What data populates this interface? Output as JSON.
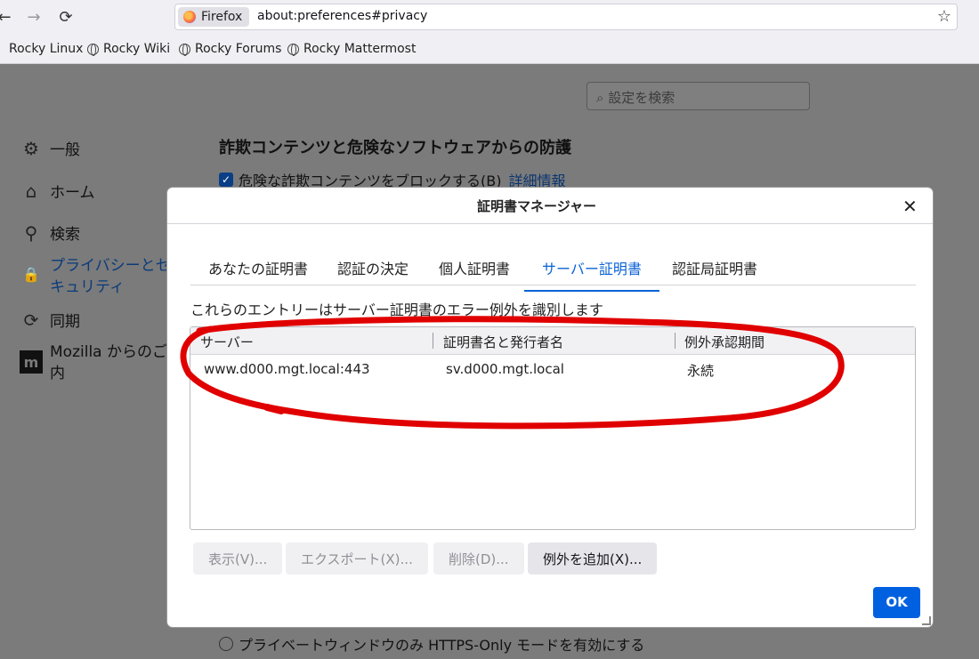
{
  "browser": {
    "identity_label": "Firefox",
    "url": "about:preferences#privacy",
    "nav": {
      "back_icon": "←",
      "forward_icon": "→",
      "reload_icon": "⟳",
      "star_icon": "☆"
    },
    "bookmarks": [
      "Rocky Linux",
      "Rocky Wiki",
      "Rocky Forums",
      "Rocky Mattermost"
    ]
  },
  "prefs": {
    "search_placeholder": "設定を検索",
    "search_icon": "⌕",
    "sidebar": [
      {
        "icon": "⚙",
        "label": "一般"
      },
      {
        "icon": "⌂",
        "label": "ホーム"
      },
      {
        "icon": "⚲",
        "label": "検索"
      },
      {
        "icon": "🔒",
        "label": "プライバシーとセ\nキュリティ"
      },
      {
        "icon": "⟳",
        "label": "同期"
      },
      {
        "icon": "m",
        "label": "Mozilla からのご案\n内"
      }
    ],
    "section_title": "詐欺コンテンツと危険なソフトウェアからの防護",
    "block_checkbox_label": "危険な詐欺コンテンツをブロックする(B)",
    "details_link": "詳細情報",
    "https_only_radio_label": "プライベートウィンドウのみ HTTPS-Only モードを有効にする"
  },
  "dialog": {
    "title": "証明書マネージャー",
    "close_icon": "✕",
    "tabs": [
      "あなたの証明書",
      "認証の決定",
      "個人証明書",
      "サーバー証明書",
      "認証局証明書"
    ],
    "selected_tab": "サーバー証明書",
    "description": "これらのエントリーはサーバー証明書のエラー例外を識別します",
    "columns": [
      "サーバー",
      "証明書名と発行者名",
      "例外承認期間"
    ],
    "rows": [
      {
        "server": "www.d000.mgt.local:443",
        "cert": "sv.d000.mgt.local",
        "period": "永続"
      }
    ],
    "buttons": {
      "view": "表示(V)...",
      "export": "エクスポート(X)...",
      "delete": "削除(D)...",
      "add_exception": "例外を追加(X)..."
    },
    "ok": "OK"
  },
  "colors": {
    "accent": "#0061e0",
    "annotation": "#e00000"
  }
}
